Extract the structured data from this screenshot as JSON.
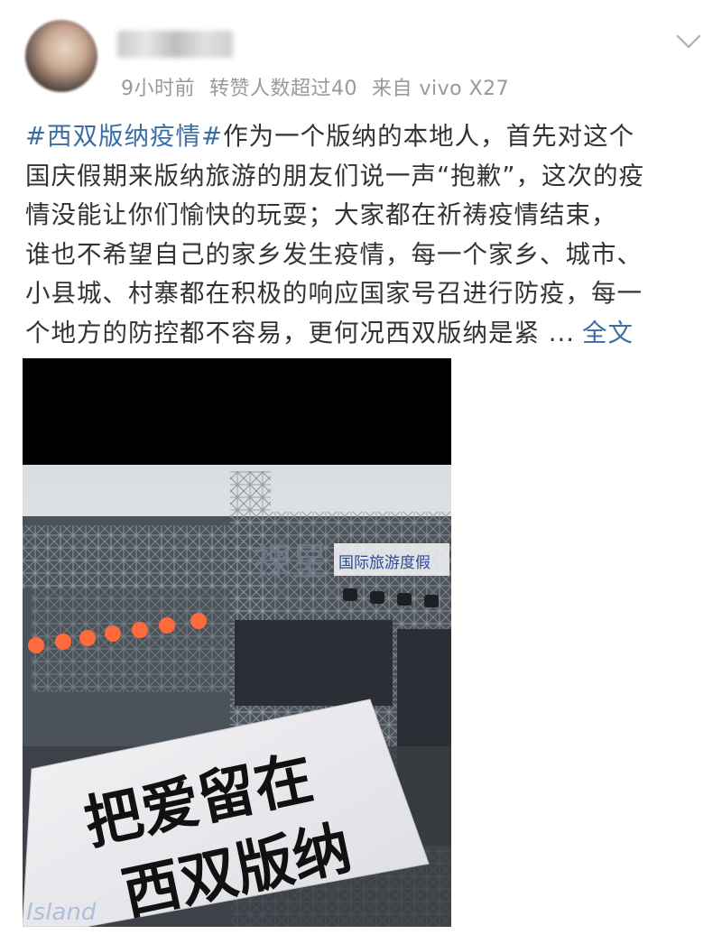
{
  "post": {
    "timestamp": "9小时前",
    "reposts": "转赞人数超过40",
    "source": "来自 vivo X27",
    "hashtag": "#西双版纳疫情#",
    "lines": [
      "作为一个版纳的本地人，首先对这个",
      "国庆假期来版纳旅游的朋友们说一声“抱歉”，这次的疫",
      "情没能让你们愉快的玩耍；大家都在祈祷疫情结束，",
      "谁也不希望自己的家乡发生疫情，每一个家乡、城市、",
      "小县城、村寨都在积极的响应国家号召进行防疫，每一",
      "个地方的防控都不容易，更何况西双版纳是紧 ..."
    ],
    "full_text_link": "全文"
  },
  "photo": {
    "banner_line1": "把爱留在",
    "banner_line2": "西双版纳",
    "sign_text": "国际旅游度假",
    "logo_text": "Island"
  },
  "icons": {
    "more": "chevron-down-icon",
    "avatar": "avatar"
  },
  "colors": {
    "link": "#3a6ea5",
    "meta": "#999999",
    "text": "#333333"
  }
}
